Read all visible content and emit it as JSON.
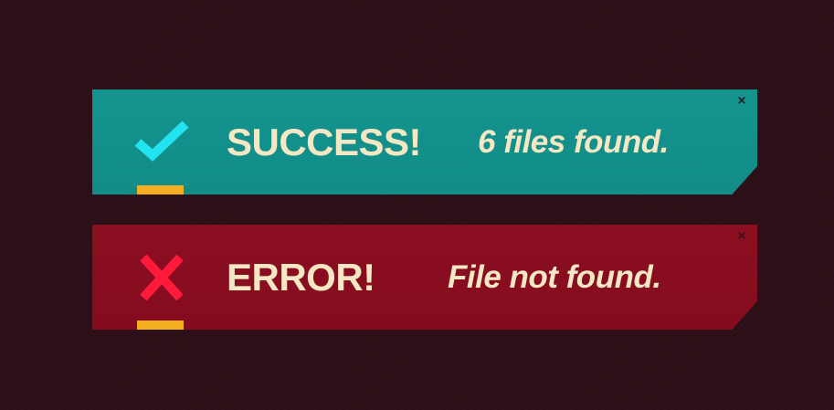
{
  "alerts": {
    "success": {
      "status_icon": "checkmark-icon",
      "title": "SUCCESS!",
      "message": "6 files found.",
      "close_icon": "close-icon",
      "close_glyph": "×",
      "colors": {
        "background": "#14948f",
        "icon": "#22e3f0",
        "text": "#f3e7c4",
        "accent_bar": "#f4ae22"
      }
    },
    "error": {
      "status_icon": "x-mark-icon",
      "title": "ERROR!",
      "message": "File not found.",
      "close_icon": "close-icon",
      "close_glyph": "×",
      "colors": {
        "background": "#8c0e21",
        "icon": "#ff1a3c",
        "text": "#f3e7c4",
        "accent_bar": "#f4ae22"
      }
    }
  },
  "page": {
    "background": "#2e1118"
  }
}
